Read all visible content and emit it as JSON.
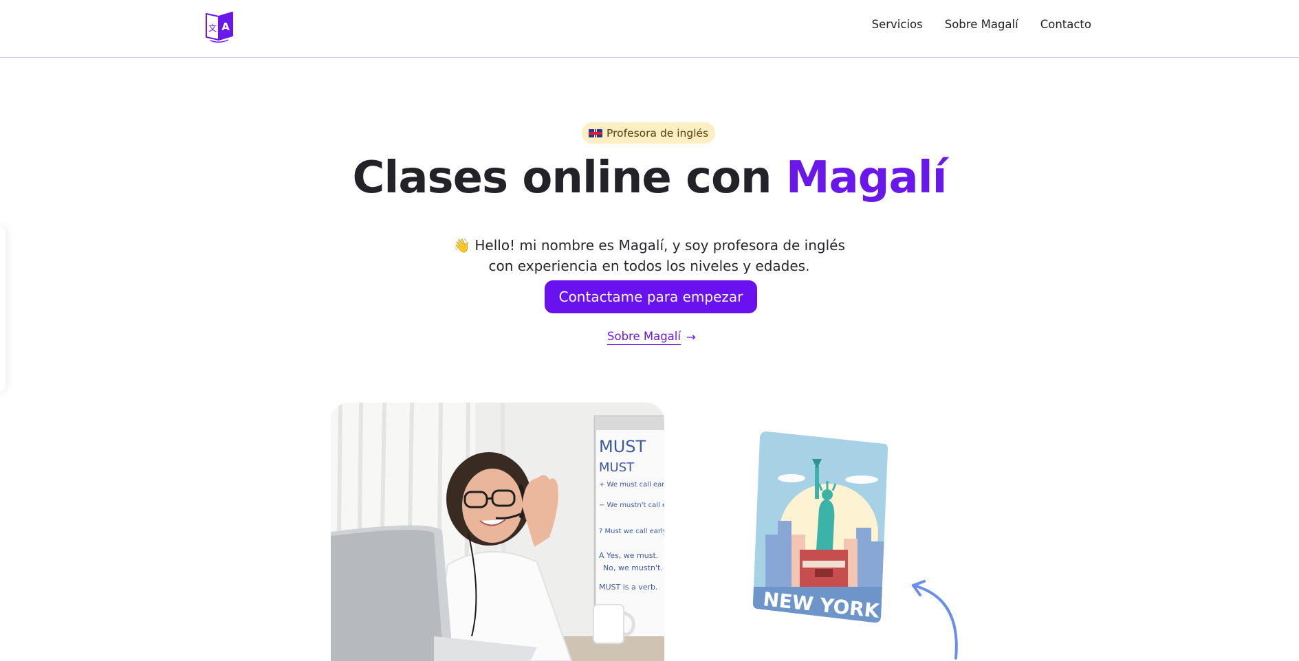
{
  "header": {
    "logo_icon": "translate-book-icon",
    "logo_glyph_left": "文",
    "logo_glyph_right": "A",
    "nav": [
      {
        "label": "Servicios"
      },
      {
        "label": "Sobre Magalí"
      },
      {
        "label": "Contacto"
      }
    ]
  },
  "hero": {
    "badge_flag_icon": "uk-flag-icon",
    "badge": "Profesora de inglés",
    "title_main": "Clases online con ",
    "title_accent": "Magalí",
    "wave_icon": "waving-hand-icon",
    "wave_emoji": "👋",
    "subtitle": "Hello! mi nombre es Magalí, y soy profesora de inglés con experiencia en todos los niveles y edades.",
    "cta_label": "Contactame para empezar",
    "about_link": "Sobre Magalí",
    "about_link_icon": "arrow-right-icon",
    "about_link_arrow": "→"
  },
  "media": {
    "photo": {
      "whiteboard": [
        "MUST",
        "MUST",
        "+ We must call early",
        "− We mustn't call early",
        "? Must we call early?",
        "A Yes, we must.",
        "No, we mustn't.",
        "MUST is a verb."
      ]
    },
    "ny_card": {
      "label": "NEW YORK"
    }
  },
  "colors": {
    "accent": "#6a17ec",
    "cta_bg": "#6a11ef",
    "badge_bg": "#fcefc3",
    "header_border": "#c9c3f2",
    "card_blue": "#6d95c9",
    "arrow_blue": "#6b8fe6"
  }
}
